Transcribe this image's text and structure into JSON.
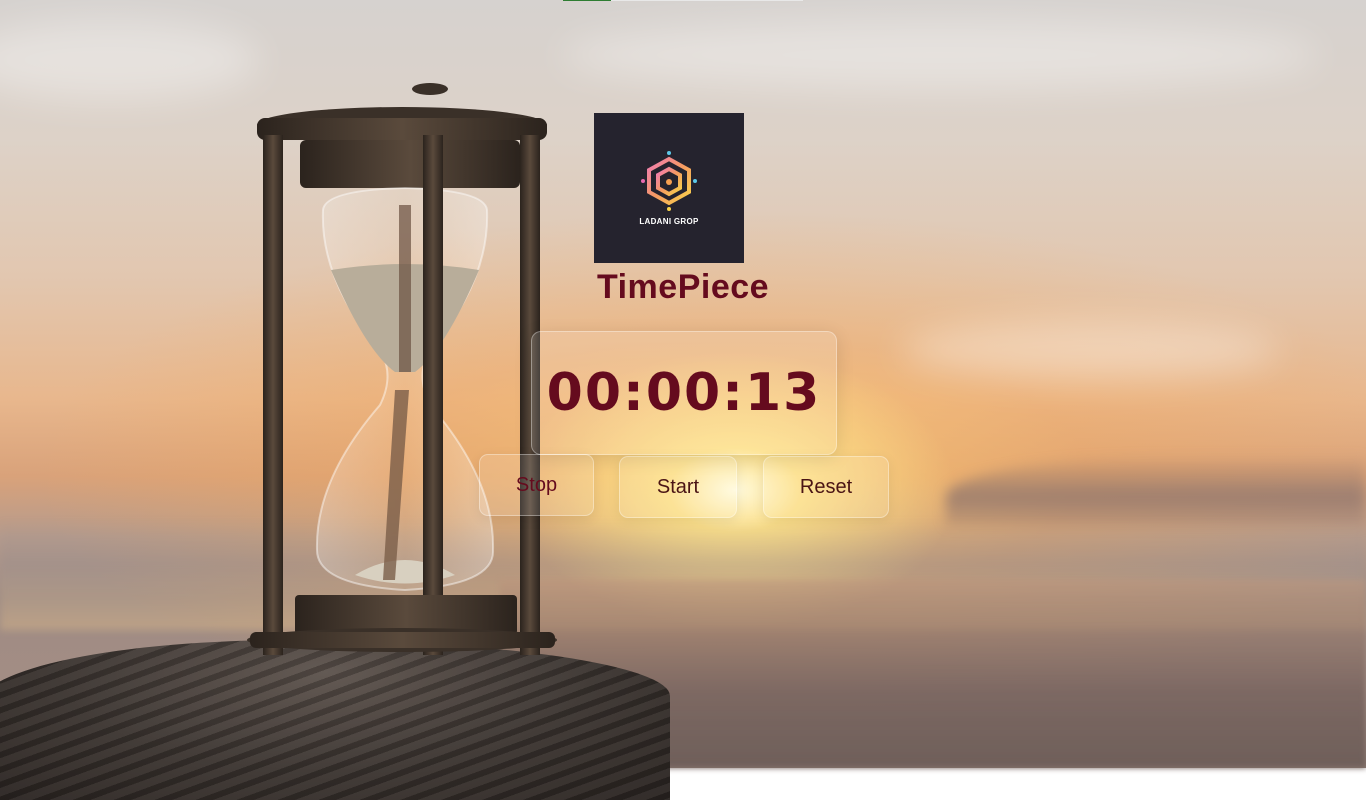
{
  "progress_bar": {
    "fill_fraction": 0.2,
    "fill_color": "#2e7d32",
    "track_color": "#e8e8e8"
  },
  "logo": {
    "icon": "hexagon-spiral-logo-icon",
    "text": "LADANI GROP"
  },
  "app": {
    "title": "TimePiece",
    "accent_color": "#650b1e"
  },
  "timer": {
    "display": "00:00:13"
  },
  "controls": {
    "stop_label": "Stop",
    "start_label": "Start",
    "reset_label": "Reset"
  }
}
